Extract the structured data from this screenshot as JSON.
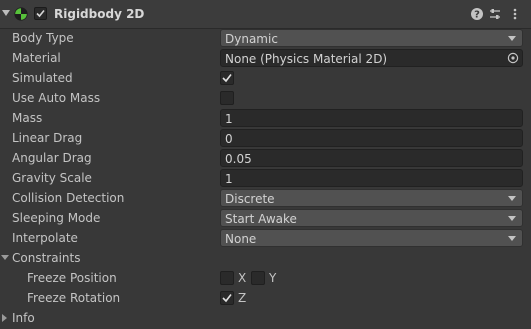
{
  "component": {
    "title": "Rigidbody 2D",
    "enabled": true
  },
  "icons": {
    "component": "rigidbody-2d-icon",
    "help": "help-icon",
    "presets": "presets-icon",
    "menu": "context-menu-icon",
    "object_picker": "object-picker-icon"
  },
  "colors": {
    "panel_bg": "#383838",
    "dropdown_bg": "#515151",
    "input_bg": "#2a2a2a",
    "icon_green": "#57c23b"
  },
  "fields": {
    "body_type": {
      "label": "Body Type",
      "value": "Dynamic"
    },
    "material": {
      "label": "Material",
      "value": "None (Physics Material 2D)"
    },
    "simulated": {
      "label": "Simulated",
      "checked": true
    },
    "use_auto_mass": {
      "label": "Use Auto Mass",
      "checked": false
    },
    "mass": {
      "label": "Mass",
      "value": "1"
    },
    "linear_drag": {
      "label": "Linear Drag",
      "value": "0"
    },
    "angular_drag": {
      "label": "Angular Drag",
      "value": "0.05"
    },
    "gravity_scale": {
      "label": "Gravity Scale",
      "value": "1"
    },
    "collision_detection": {
      "label": "Collision Detection",
      "value": "Discrete"
    },
    "sleeping_mode": {
      "label": "Sleeping Mode",
      "value": "Start Awake"
    },
    "interpolate": {
      "label": "Interpolate",
      "value": "None"
    }
  },
  "constraints": {
    "label": "Constraints",
    "expanded": true,
    "freeze_position": {
      "label": "Freeze Position",
      "x_label": "X",
      "x": false,
      "y_label": "Y",
      "y": false
    },
    "freeze_rotation": {
      "label": "Freeze Rotation",
      "z_label": "Z",
      "z": true
    }
  },
  "info": {
    "label": "Info",
    "expanded": false
  }
}
